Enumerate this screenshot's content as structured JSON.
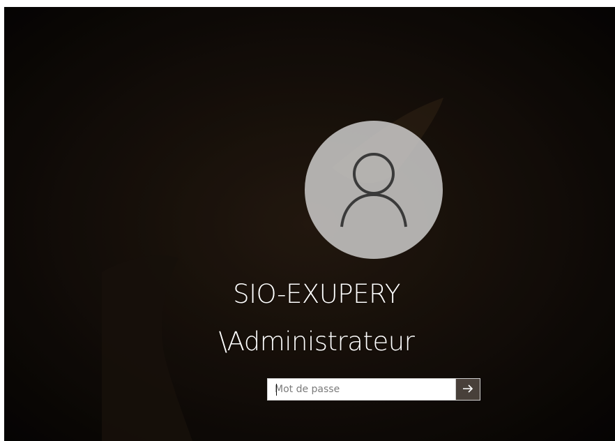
{
  "login": {
    "username_line1": "SIO-EXUPERY",
    "username_line2": "\\Administrateur",
    "password_placeholder": "Mot de passe",
    "password_value": ""
  },
  "icons": {
    "avatar": "user-icon",
    "submit": "arrow-right-icon"
  },
  "colors": {
    "text": "#ffffff",
    "avatar_bg": "#dcdcdc"
  }
}
